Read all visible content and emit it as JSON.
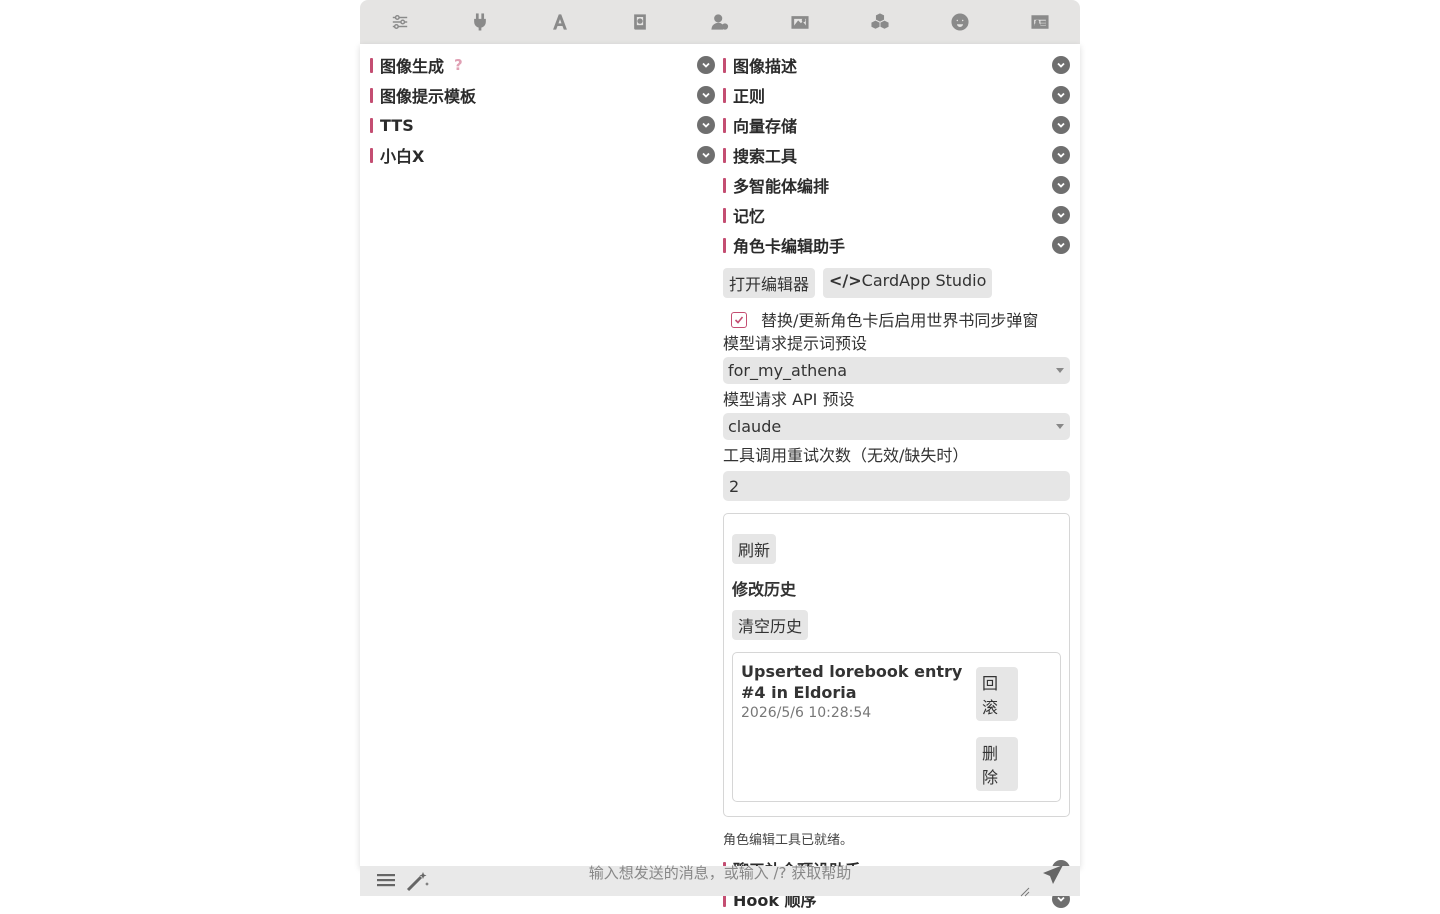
{
  "topbar": {
    "icons": [
      "sliders-icon",
      "plug-icon",
      "font-icon",
      "book-icon",
      "user-gear-icon",
      "image-icon",
      "cubes-icon",
      "smile-icon",
      "id-card-icon"
    ]
  },
  "left": {
    "drawers": [
      {
        "label": "图像生成",
        "help": "?"
      },
      {
        "label": "图像提示模板"
      },
      {
        "label": "TTS"
      },
      {
        "label": "小白X"
      }
    ]
  },
  "right": {
    "drawers": [
      {
        "label": "图像描述"
      },
      {
        "label": "正则"
      },
      {
        "label": "向量存储"
      },
      {
        "label": "搜索工具"
      },
      {
        "label": "多智能体编排"
      },
      {
        "label": "记忆"
      },
      {
        "label": "角色卡编辑助手"
      }
    ],
    "card_helper": {
      "open_editor": "打开编辑器",
      "studio_icon": "</>",
      "studio": "CardApp Studio",
      "sync_checkbox_label": "替换/更新角色卡后启用世界书同步弹窗",
      "sync_checked": true,
      "prompt_preset_label": "模型请求提示词预设",
      "prompt_preset_value": "for_my_athena",
      "api_preset_label": "模型请求 API 预设",
      "api_preset_value": "claude",
      "retry_label": "工具调用重试次数（无效/缺失时）",
      "retry_value": "2",
      "refresh": "刷新",
      "history_title": "修改历史",
      "clear_history": "清空历史",
      "entry": {
        "title": "Upserted lorebook entry #4 in Eldoria",
        "time": "2026/5/6 10:28:54",
        "rollback": "回滚",
        "delete": "删除"
      },
      "status": "角色编辑工具已就绪。"
    },
    "bottom_drawers": [
      {
        "label": "聊天补全预设助手"
      },
      {
        "label": "Hook 顺序"
      }
    ]
  },
  "footer": {
    "placeholder": "输入想发送的消息，或输入 /? 获取帮助"
  }
}
